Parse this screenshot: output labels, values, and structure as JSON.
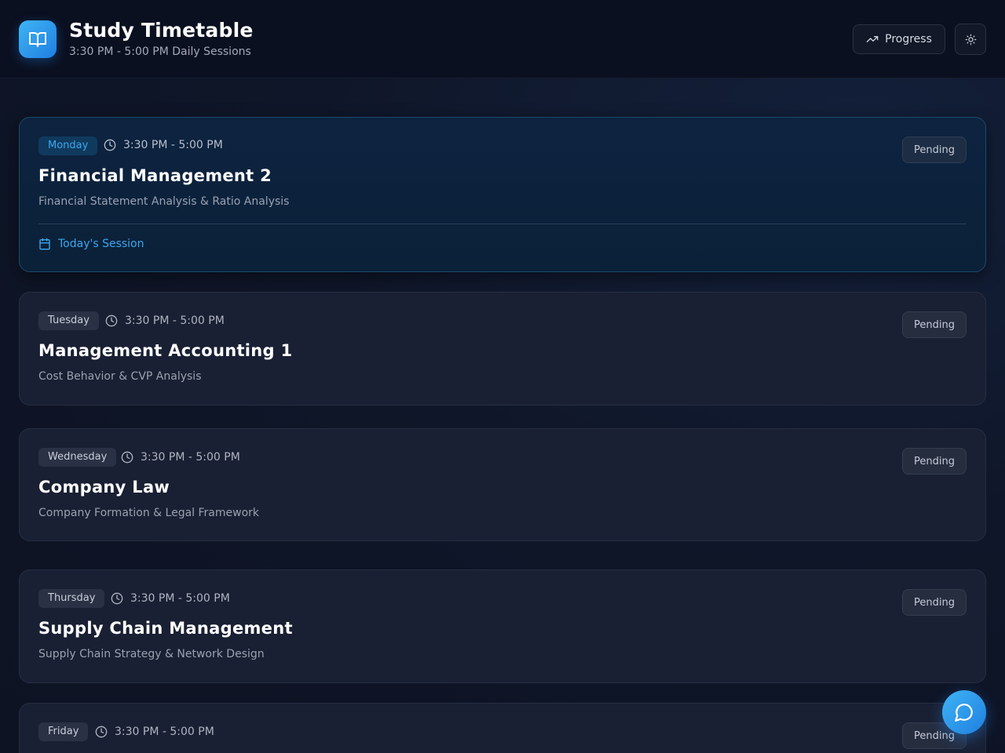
{
  "header": {
    "title": "Study Timetable",
    "subtitle": "3:30 PM - 5:00 PM Daily Sessions",
    "progress_label": "Progress",
    "logo_icon": "book-open-icon",
    "theme_icon": "sun-icon"
  },
  "sessions": [
    {
      "day": "Monday",
      "time": "3:30 PM - 5:00 PM",
      "subject": "Financial Management 2",
      "topic": "Financial Statement Analysis & Ratio Analysis",
      "status": "Pending",
      "today_label": "Today's Session",
      "is_today": true
    },
    {
      "day": "Tuesday",
      "time": "3:30 PM - 5:00 PM",
      "subject": "Management Accounting 1",
      "topic": "Cost Behavior & CVP Analysis",
      "status": "Pending"
    },
    {
      "day": "Wednesday",
      "time": "3:30 PM - 5:00 PM",
      "subject": "Company Law",
      "topic": "Company Formation & Legal Framework",
      "status": "Pending"
    },
    {
      "day": "Thursday",
      "time": "3:30 PM - 5:00 PM",
      "subject": "Supply Chain Management",
      "topic": "Supply Chain Strategy & Network Design",
      "status": "Pending"
    },
    {
      "day": "Friday",
      "time": "3:30 PM - 5:00 PM",
      "status": "Pending"
    }
  ],
  "colors": {
    "accent": "#3aa8ef",
    "background": "#0f1629",
    "card": "#1a2033",
    "active_card": "#0d2340"
  },
  "chat_icon": "message-circle-icon"
}
